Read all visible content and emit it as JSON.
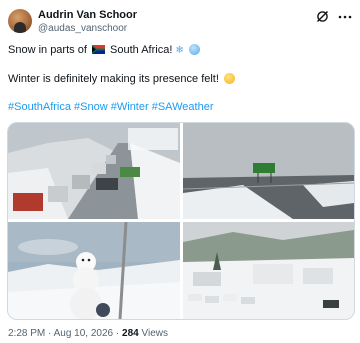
{
  "author": {
    "name": "Audrin Van Schoor",
    "handle": "@audas_vanschoor"
  },
  "tweet": {
    "line1_text": "Snow in parts of",
    "line1_country": "South Africa!",
    "line1_emoji_1": "snowflake",
    "line1_emoji_2": "cold-face",
    "line2_text": "Winter is definitely making its presence felt!",
    "line2_emoji": "grimacing-face",
    "hashtags": [
      "#SouthAfrica",
      "#Snow",
      "#Winter",
      "#SAWeather"
    ]
  },
  "media": [
    {
      "alt_icon": "photo-snowy-road-trucks"
    },
    {
      "alt_icon": "photo-snowy-highway-sign"
    },
    {
      "alt_icon": "photo-snowman"
    },
    {
      "alt_icon": "photo-snowy-parking-lot"
    }
  ],
  "meta": {
    "time": "2:28 PM",
    "separator": "·",
    "date": "Aug 10, 2026",
    "views_count": "284",
    "views_label": "Views"
  },
  "colors": {
    "link": "#1d9bf0",
    "text": "#0f1419",
    "muted": "#536471"
  }
}
